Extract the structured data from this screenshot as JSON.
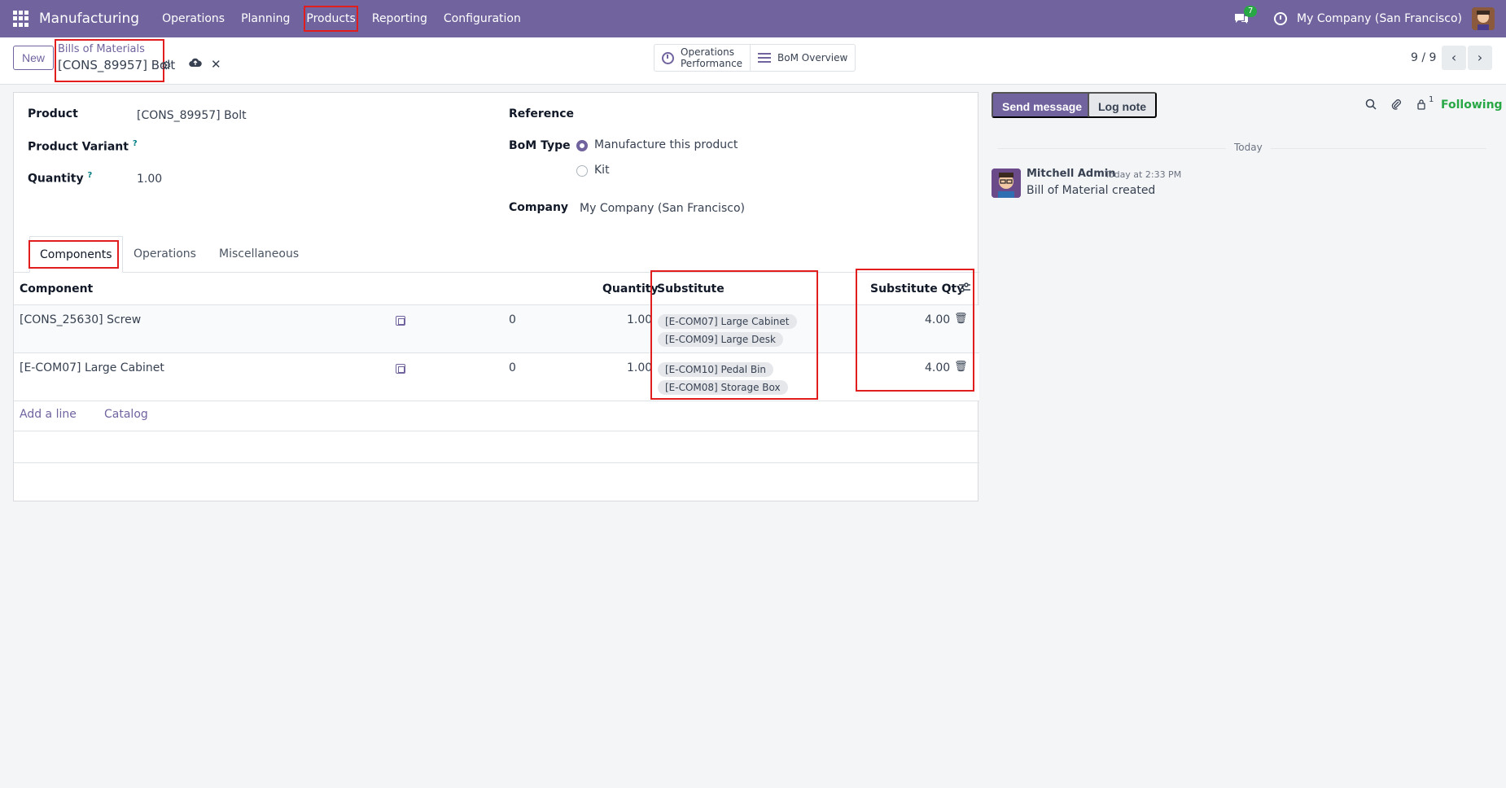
{
  "topbar": {
    "app_name": "Manufacturing",
    "menu": [
      "Operations",
      "Planning",
      "Products",
      "Reporting",
      "Configuration"
    ],
    "highlighted_menu": "Products",
    "chat_badge": "7",
    "company": "My Company (San Francisco)"
  },
  "control": {
    "new_label": "New",
    "breadcrumb_parent": "Bills of Materials",
    "breadcrumb_current": "[CONS_89957] Bolt",
    "smart_buttons": {
      "operations_line1": "Operations",
      "operations_line2": "Performance",
      "bom_overview": "BoM Overview"
    },
    "pager": "9 / 9"
  },
  "form": {
    "product_label": "Product",
    "product_value": "[CONS_89957] Bolt",
    "variant_label": "Product Variant",
    "quantity_label": "Quantity",
    "quantity_value": "1.00",
    "reference_label": "Reference",
    "bom_type_label": "BoM Type",
    "bom_type_options": [
      "Manufacture this product",
      "Kit"
    ],
    "bom_type_selected": "Manufacture this product",
    "company_label": "Company",
    "company_value": "My Company (San Francisco)",
    "help_mark": "?"
  },
  "tabs": [
    "Components",
    "Operations",
    "Miscellaneous"
  ],
  "active_tab": "Components",
  "table": {
    "headers": {
      "component": "Component",
      "quantity": "Quantity",
      "substitute": "Substitute",
      "substitute_qty": "Substitute Qty"
    },
    "rows": [
      {
        "component": "[CONS_25630] Screw",
        "col3": "0",
        "quantity": "1.00",
        "substitutes": [
          "[E-COM07] Large Cabinet",
          "[E-COM09] Large Desk"
        ],
        "substitute_qty": "4.00"
      },
      {
        "component": "[E-COM07] Large Cabinet",
        "col3": "0",
        "quantity": "1.00",
        "substitutes": [
          "[E-COM10] Pedal Bin",
          "[E-COM08] Storage Box"
        ],
        "substitute_qty": "4.00"
      }
    ],
    "add_line": "Add a line",
    "catalog": "Catalog"
  },
  "chatter": {
    "send_message": "Send message",
    "log_note": "Log note",
    "follower_count": "1",
    "following": "Following",
    "today": "Today",
    "message": {
      "author": "Mitchell Admin",
      "time": "Today at 2:33 PM",
      "body": "Bill of Material created"
    }
  },
  "colors": {
    "brand": "#71639e",
    "highlight_box": "#e11d1d",
    "following": "#28a745"
  }
}
